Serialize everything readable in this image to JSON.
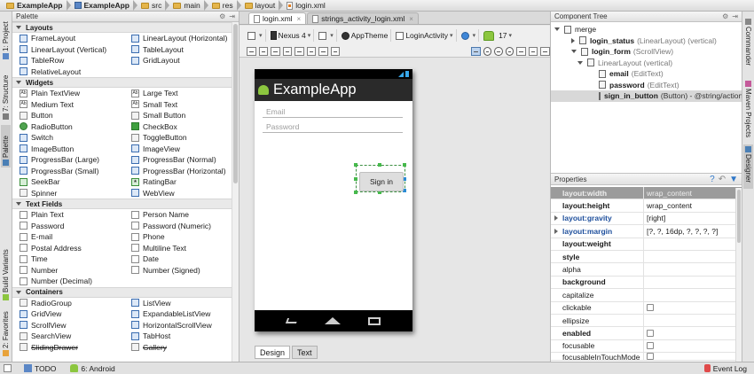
{
  "breadcrumbs": [
    "ExampleApp",
    "ExampleApp",
    "src",
    "main",
    "res",
    "layout",
    "login.xml"
  ],
  "left_strip": [
    "1: Project",
    "7: Structure",
    "Palette",
    "Build Variants",
    "2: Favorites"
  ],
  "right_strip": [
    "Commander",
    "Maven Projects",
    "Designer"
  ],
  "palette": {
    "title": "Palette",
    "groups": [
      {
        "name": "Layouts",
        "items": [
          "FrameLayout",
          "LinearLayout (Horizontal)",
          "LinearLayout (Vertical)",
          "TableLayout",
          "TableRow",
          "GridLayout",
          "RelativeLayout"
        ]
      },
      {
        "name": "Widgets",
        "items": [
          "Plain TextView",
          "Large Text",
          "Medium Text",
          "Small Text",
          "Button",
          "Small Button",
          "RadioButton",
          "CheckBox",
          "Switch",
          "ToggleButton",
          "ImageButton",
          "ImageView",
          "ProgressBar (Large)",
          "ProgressBar (Normal)",
          "ProgressBar (Small)",
          "ProgressBar (Horizontal)",
          "SeekBar",
          "RatingBar",
          "Spinner",
          "WebView"
        ]
      },
      {
        "name": "Text Fields",
        "items": [
          "Plain Text",
          "Person Name",
          "Password",
          "Password (Numeric)",
          "E-mail",
          "Phone",
          "Postal Address",
          "Multiline Text",
          "Time",
          "Date",
          "Number",
          "Number (Signed)",
          "Number (Decimal)"
        ]
      },
      {
        "name": "Containers",
        "items": [
          "RadioGroup",
          "ListView",
          "GridView",
          "ExpandableListView",
          "ScrollView",
          "HorizontalScrollView",
          "SearchView",
          "TabHost",
          "SlidingDrawer",
          "Gallery"
        ]
      }
    ]
  },
  "editor": {
    "tabs": [
      "login.xml",
      "strings_activity_login.xml"
    ],
    "toolbar": {
      "device": "Nexus 4",
      "theme": "AppTheme",
      "activity": "LoginActivity",
      "api": "17"
    },
    "preview": {
      "app_title": "ExampleApp",
      "email_hint": "Email",
      "password_hint": "Password",
      "button": "Sign in"
    },
    "bottom_tabs": [
      "Design",
      "Text"
    ]
  },
  "component_tree": {
    "title": "Component Tree",
    "nodes": [
      {
        "name": "merge",
        "sub": ""
      },
      {
        "name": "login_status",
        "sub": "(LinearLayout) (vertical)"
      },
      {
        "name": "login_form",
        "sub": "(ScrollView)"
      },
      {
        "name": "",
        "sub": "LinearLayout (vertical)"
      },
      {
        "name": "email",
        "sub": "(EditText)"
      },
      {
        "name": "password",
        "sub": "(EditText)"
      },
      {
        "name": "sign_in_button",
        "sub": "(Button) - @string/action"
      }
    ]
  },
  "properties": {
    "title": "Properties",
    "rows": [
      {
        "key": "layout:width",
        "value": "wrap_content"
      },
      {
        "key": "layout:height",
        "value": "wrap_content"
      },
      {
        "key": "layout:gravity",
        "value": "[right]"
      },
      {
        "key": "layout:margin",
        "value": "[?, ?, 16dp, ?, ?, ?, ?]"
      },
      {
        "key": "layout:weight",
        "value": ""
      },
      {
        "key": "style",
        "value": ""
      },
      {
        "key": "alpha",
        "value": ""
      },
      {
        "key": "background",
        "value": ""
      },
      {
        "key": "capitalize",
        "value": ""
      },
      {
        "key": "clickable",
        "value": ""
      },
      {
        "key": "ellipsize",
        "value": ""
      },
      {
        "key": "enabled",
        "value": ""
      },
      {
        "key": "focusable",
        "value": ""
      },
      {
        "key": "focusableInTouchMode",
        "value": ""
      }
    ]
  },
  "bottom_bar": {
    "todo": "TODO",
    "android": "6: Android",
    "event_log": "Event Log"
  }
}
